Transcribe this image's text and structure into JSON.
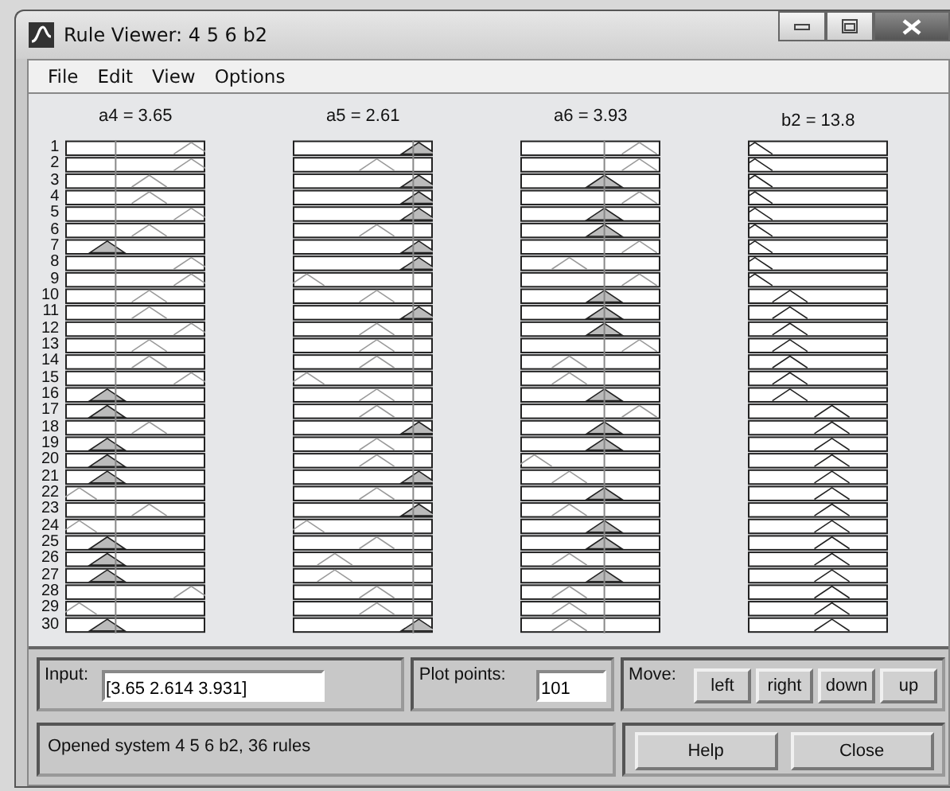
{
  "window": {
    "title": "Rule Viewer: 4 5 6 b2"
  },
  "menu": [
    "File",
    "Edit",
    "View",
    "Options"
  ],
  "variables": [
    {
      "label": "a4 = 3.65",
      "kind": "input"
    },
    {
      "label": "a5 = 2.61",
      "kind": "input"
    },
    {
      "label": "a6 = 3.93",
      "kind": "input"
    },
    {
      "label": "b2 = 13.8",
      "kind": "output"
    }
  ],
  "rules": [
    "1",
    "2",
    "3",
    "4",
    "5",
    "6",
    "7",
    "8",
    "9",
    "10",
    "11",
    "12",
    "13",
    "14",
    "15",
    "16",
    "17",
    "18",
    "19",
    "20",
    "21",
    "22",
    "23",
    "24",
    "25",
    "26",
    "27",
    "28",
    "29",
    "30"
  ],
  "input": {
    "label": "Input:",
    "value": "[3.65 2.614 3.931]"
  },
  "plot_points": {
    "label": "Plot points:",
    "value": "101"
  },
  "move": {
    "label": "Move:",
    "buttons": [
      "left",
      "right",
      "down",
      "up"
    ]
  },
  "status": "Opened system 4 5 6 b2, 36 rules",
  "buttons": [
    "Help",
    "Close"
  ]
}
